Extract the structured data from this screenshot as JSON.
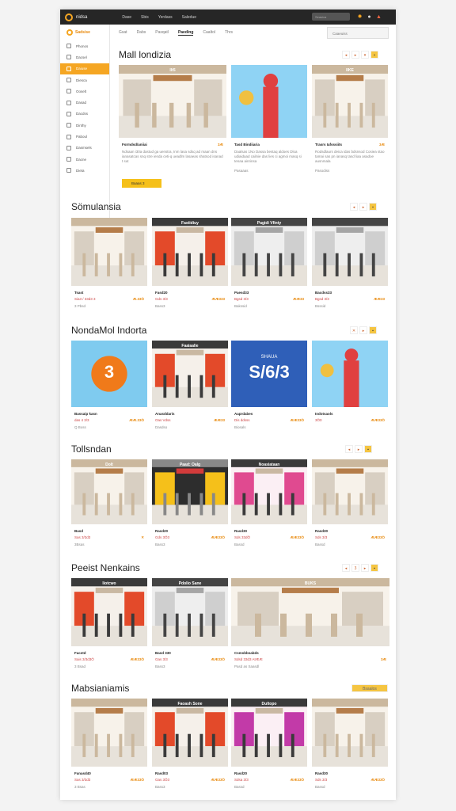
{
  "topbar": {
    "brand": "nidsa",
    "nav": [
      "Dase",
      "Sbis",
      "Yerdass",
      "Saledue"
    ],
    "search_placeholder": "Seasiva",
    "icons": [
      "gear-icon",
      "user-icon",
      "bell-icon"
    ]
  },
  "sidebar": {
    "brand": "Sadsise",
    "items": [
      {
        "label": "Phonos",
        "active": false
      },
      {
        "label": "Dacsel",
        "active": false
      },
      {
        "label": "Daiuse",
        "active": true
      },
      {
        "label": "Diesca",
        "active": false
      },
      {
        "label": "Ooselt",
        "active": false
      },
      {
        "label": "Dasad",
        "active": false
      },
      {
        "label": "Dacdss",
        "active": false
      },
      {
        "label": "Dinthy",
        "active": false
      },
      {
        "label": "Paboul",
        "active": false
      },
      {
        "label": "Dasmsels",
        "active": false
      },
      {
        "label": "Dacne",
        "active": false
      },
      {
        "label": "Dieta",
        "active": false
      }
    ]
  },
  "tabs": [
    "Gsat",
    "Dabs",
    "Pasqatl",
    "Paeding",
    "Caaltol",
    "Thrs"
  ],
  "active_tab": "Paeding",
  "top_search": "Caaeuiss",
  "sections": [
    {
      "title": "Mall londizia",
      "chips": [
        "◂",
        "▸",
        "▾",
        "▪"
      ],
      "cards": [
        {
          "name": "Fsrmdsd/aniiai",
          "price": "3Æ",
          "desc": "Ndsaan i30a dastud ga uenstra, Inm lasa sdsq ad maan dns ianasatcas snq stre ienda ceti-q ueadlm lasaeas shatsod isanad t sut",
          "meta": "",
          "button": "Baaas 3"
        },
        {
          "name": "Tasd Bindiiaria",
          "price": "",
          "desc": "Daalsas 1No Dassa bestaq aldoes Dloa udiaidaad cailnie das lies ci agmoi masq si tenaa ainrinsa",
          "meta": "Pasaaas",
          "button": ""
        },
        {
          "name": "Trasrs Iafsssiits",
          "price": "3Æ",
          "desc": "Rodsdlaurs deica idas bdsnsod Cosiea stao tamai sas pn ianasq tasd liaa asadoe ausnmala",
          "meta": "Pasodiss",
          "button": ""
        }
      ]
    },
    {
      "title": "Sömulansia",
      "chips": [
        "◂",
        "▸",
        "▪"
      ],
      "cards": [
        {
          "name": "Tsast",
          "price": "",
          "sub": "Sia3 / 33d3 3",
          "meta": "3 Pbsd",
          "price2": "Æ.33Ö"
        },
        {
          "name": "Fasd20",
          "price": "",
          "sub": "Gds  3/3",
          "meta": "Bass3",
          "price2": "ÆÆ333"
        },
        {
          "name": "Paesd33",
          "price": "",
          "sub": "Bgsd 3/3",
          "meta": "Bakssid",
          "price2": "ÆÆ33"
        },
        {
          "name": "Bacdss33",
          "price": "",
          "sub": "Bgsd 3/3",
          "meta": "Bsssid",
          "price2": "ÆÆ33"
        }
      ]
    },
    {
      "title": "NondaMol Indorta",
      "chips": [
        "✕",
        "▸",
        "▪"
      ],
      "cards": [
        {
          "name": "Bassaip kasn",
          "sub": "das 4 3/3",
          "meta": "Q Boss",
          "price2": "ÆÆ.33Ö"
        },
        {
          "name": "Anasddaris",
          "sub": "Oas Vdss",
          "meta": "Dasdso",
          "price2": "ÆÆ33"
        },
        {
          "name": "Aaprdabes",
          "sub": "Dis ddsss",
          "meta": "Biosals",
          "price2": "ÆÆ33Ö"
        },
        {
          "name": "Indotsaols",
          "sub": "3Ö0",
          "meta": "",
          "price2": "ÆÆ33Ö"
        }
      ]
    },
    {
      "title": "Tollsndan",
      "chips": [
        "◂",
        "▸",
        "▪"
      ],
      "cards": [
        {
          "name": "Basd",
          "sub": "Sas 3/3d3",
          "meta": "3Bsas",
          "price2": "✕"
        },
        {
          "name": "Rasd20",
          "sub": "Gds 3Ö3",
          "meta": "Bass3",
          "price2": "ÆÆ33Ö"
        },
        {
          "name": "Rasd30",
          "sub": "Sds 33dÖ",
          "meta": "Bassd",
          "price2": "ÆÆ33Ö"
        },
        {
          "name": "Rasd30",
          "sub": "Sds 3/3",
          "meta": "Bassd",
          "price2": "ÆÆ33Ö"
        }
      ]
    },
    {
      "title": "Peeist Nenkains",
      "chips": [
        "◂",
        "3",
        "▸",
        "▪"
      ],
      "cards": [
        {
          "name": "Facstd",
          "sub": "Sais 3/3d3Ö",
          "meta": "3 Bsad",
          "price2": "ÆÆ33Ö"
        },
        {
          "name": "Basd 330",
          "sub": "Gas 3/3",
          "meta": "Bass3",
          "price2": "ÆÆ33Ö"
        },
        {
          "name": "Csmsbbsabds",
          "sub": "Sdsd 33d3 AtÆÆ",
          "meta": "Pasd as Saasdl",
          "price2": "3Æ"
        }
      ]
    },
    {
      "title": "Mabsianiamis",
      "chips": [
        "Bsaalos"
      ],
      "cards": [
        {
          "name": "Fanasd40",
          "sub": "Sas 3/3d3",
          "meta": "3 Bsas",
          "price2": "ÆÆ33Ö"
        },
        {
          "name": "Rasd03",
          "sub": "Gas 3Ö3",
          "meta": "Bass3",
          "price2": "ÆÆ33Ö"
        },
        {
          "name": "Rasd20",
          "sub": "Sdsa 3/3",
          "meta": "Bassd",
          "price2": "ÆÆ33Ö"
        },
        {
          "name": "Rasd30",
          "sub": "Sds 3/3",
          "meta": "Bassd",
          "price2": "ÆÆ33Ö"
        }
      ]
    }
  ],
  "thumb_overlays": {
    "s0c0": "Ilt5",
    "s0c2": "IIKE",
    "s1c1": "Fastidiuy",
    "s1c2": "Pagidi Vfinty",
    "s2c0": "3",
    "s2c1": "Faaiaalie",
    "s2c2": "S/6/3",
    "s2c2_brand": "SHAUA",
    "s3c0": "Dolt",
    "s3c1": "Paad: Oalg",
    "s3c2": "Noasiataan",
    "s4c0": "Iiotcwo",
    "s4c1": "Pdolio Sane",
    "s4c2": "BUKS",
    "s5c1": "Faoash Sone",
    "s5c2": "Dultopo"
  },
  "colors": {
    "accent": "#f5a623",
    "dark": "#262626",
    "price": "#e8890c"
  }
}
